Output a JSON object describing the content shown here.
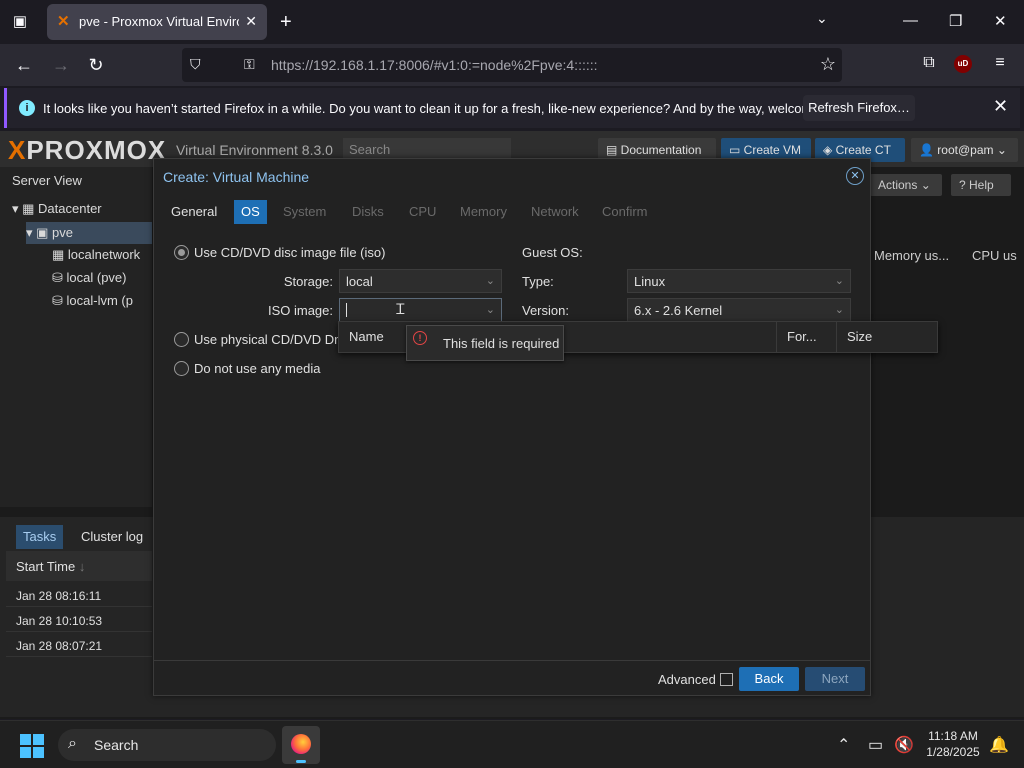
{
  "browser": {
    "tab_title": "pve - Proxmox Virtual Environm",
    "url_host": "https://192.168.1.17",
    "url_rest": ":8006/#v1:0:=node%2Fpve:4::::::",
    "ublock_badge": "uD"
  },
  "notification": {
    "message": "It looks like you haven’t started Firefox in a while. Do you want to clean it up for a fresh, like-new experience? And by the way, welcome back!",
    "button": "Refresh Firefox…"
  },
  "pve": {
    "logo_brand": "PROXMOX",
    "version": "Virtual Environment 8.3.0",
    "search_placeholder": "Search",
    "header_buttons": {
      "docs": "Documentation",
      "create_vm": "Create VM",
      "create_ct": "Create CT",
      "user": "root@pam"
    },
    "sidebar_title": "Server View",
    "tree": [
      "Datacenter",
      "pve",
      "localnetwork",
      "local (pve)",
      "local-lvm (p"
    ],
    "right_buttons": {
      "actions": "Actions",
      "help": "Help"
    },
    "right_columns": [
      "Memory us...",
      "CPU us"
    ],
    "tasks_tabs": [
      "Tasks",
      "Cluster log"
    ],
    "tasks_col": "Start Time",
    "tasks_rows": [
      "Jan 28 08:16:11",
      "Jan 28 10:10:53",
      "Jan 28 08:07:21"
    ]
  },
  "modal": {
    "title": "Create: Virtual Machine",
    "tabs": [
      "General",
      "OS",
      "System",
      "Disks",
      "CPU",
      "Memory",
      "Network",
      "Confirm"
    ],
    "active_tab": "OS",
    "media_options": [
      "Use CD/DVD disc image file (iso)",
      "Use physical CD/DVD Dr",
      "Do not use any media"
    ],
    "storage_label": "Storage:",
    "storage_value": "local",
    "iso_label": "ISO image:",
    "iso_value": "",
    "guest_os_title": "Guest OS:",
    "type_label": "Type:",
    "type_value": "Linux",
    "version_label": "Version:",
    "version_value": "6.x - 2.6 Kernel",
    "picker_columns": [
      "Name",
      "For...",
      "Size"
    ],
    "tooltip": "This field is required",
    "advanced_label": "Advanced",
    "back_button": "Back",
    "next_button": "Next"
  },
  "taskbar": {
    "search_label": "Search",
    "time": "11:18 AM",
    "date": "1/28/2025"
  },
  "colors": {
    "accent": "#1e6fb5",
    "proxmox_orange": "#e57000",
    "error": "#e24545"
  }
}
